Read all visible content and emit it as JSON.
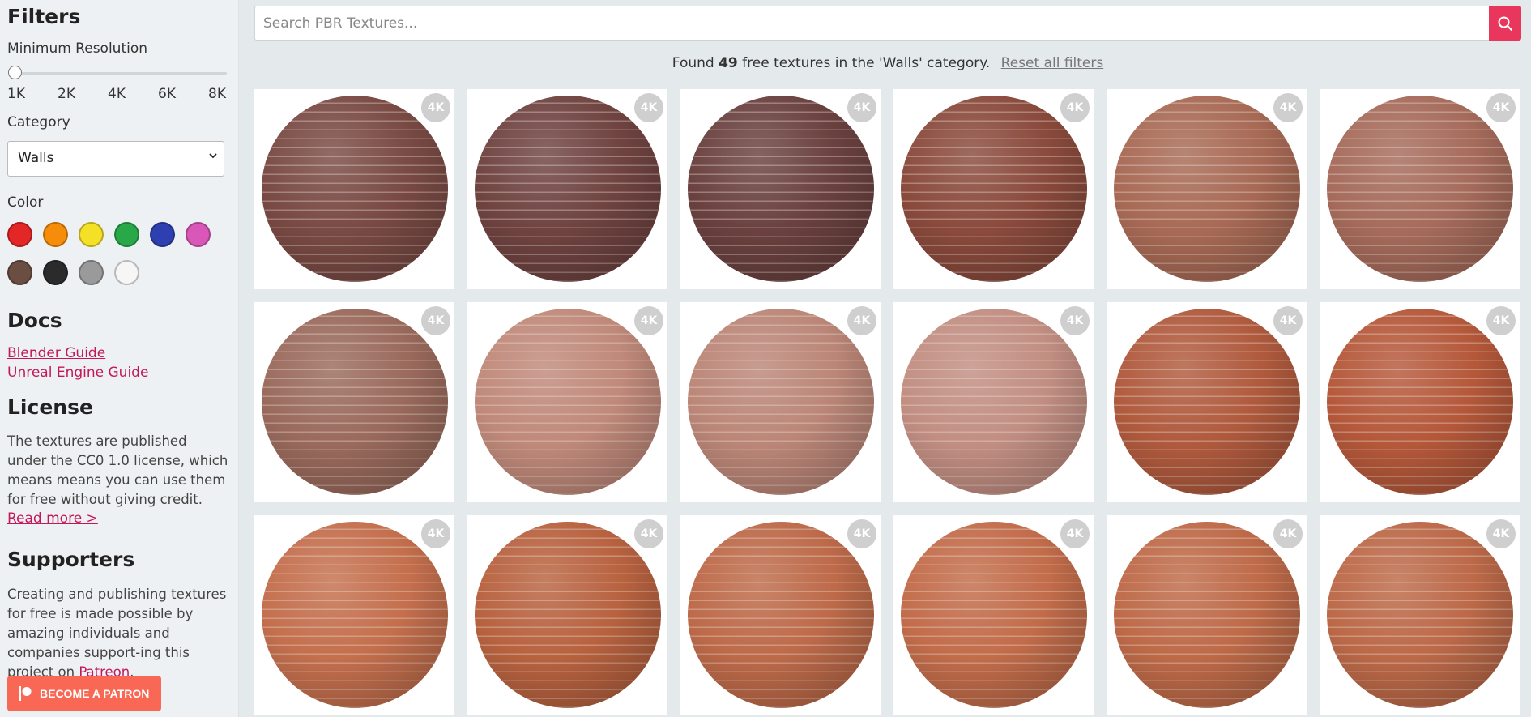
{
  "sidebar": {
    "filters_title": "Filters",
    "min_res_label": "Minimum Resolution",
    "res_ticks": [
      "1K",
      "2K",
      "4K",
      "6K",
      "8K"
    ],
    "category_label": "Category",
    "category_value": "Walls",
    "color_label": "Color",
    "colors": [
      {
        "name": "red",
        "hex": "#e32626"
      },
      {
        "name": "orange",
        "hex": "#f58d0a"
      },
      {
        "name": "yellow",
        "hex": "#f4e127"
      },
      {
        "name": "green",
        "hex": "#29a84a"
      },
      {
        "name": "blue",
        "hex": "#2e3fb0"
      },
      {
        "name": "pink",
        "hex": "#d957b8"
      },
      {
        "name": "brown",
        "hex": "#6b4e42"
      },
      {
        "name": "black",
        "hex": "#2b2b2b"
      },
      {
        "name": "gray",
        "hex": "#9a9a9a"
      },
      {
        "name": "white",
        "hex": "#f6f6f6"
      }
    ],
    "docs_title": "Docs",
    "docs_links": [
      "Blender Guide",
      "Unreal Engine Guide"
    ],
    "license_title": "License",
    "license_text": "The textures are published under the CC0 1.0 license, which means means you can use them for free without giving credit.",
    "license_link": "Read more >",
    "supporters_title": "Supporters",
    "supporters_text_before": "Creating and publishing textures for free is made possible by amazing individuals and companies support-ing this project on ",
    "supporters_link": "Patreon",
    "supporters_text_after": ".",
    "patron_button": "BECOME A PATRON"
  },
  "search": {
    "placeholder": "Search PBR Textures..."
  },
  "results": {
    "prefix": "Found ",
    "count": "49",
    "suffix": " free textures in the 'Walls' category.",
    "reset_label": "Reset all filters"
  },
  "textures": [
    {
      "badge": "4K",
      "color": "#7a4a44"
    },
    {
      "badge": "4K",
      "color": "#6f4340"
    },
    {
      "badge": "4K",
      "color": "#6a413f"
    },
    {
      "badge": "4K",
      "color": "#8a4a3c"
    },
    {
      "badge": "4K",
      "color": "#a86a55"
    },
    {
      "badge": "4K",
      "color": "#a66b5b"
    },
    {
      "badge": "4K",
      "color": "#9a6a5c"
    },
    {
      "badge": "4K",
      "color": "#c0897a"
    },
    {
      "badge": "4K",
      "color": "#bb8677"
    },
    {
      "badge": "4K",
      "color": "#c28e82"
    },
    {
      "badge": "4K",
      "color": "#b05a3d"
    },
    {
      "badge": "4K",
      "color": "#b5583a"
    },
    {
      "badge": "4K",
      "color": "#c46f4d"
    },
    {
      "badge": "4K",
      "color": "#b8623f"
    },
    {
      "badge": "4K",
      "color": "#bd6a49"
    },
    {
      "badge": "4K",
      "color": "#c26c4a"
    },
    {
      "badge": "4K",
      "color": "#be6a48"
    },
    {
      "badge": "4K",
      "color": "#bc6948"
    }
  ]
}
